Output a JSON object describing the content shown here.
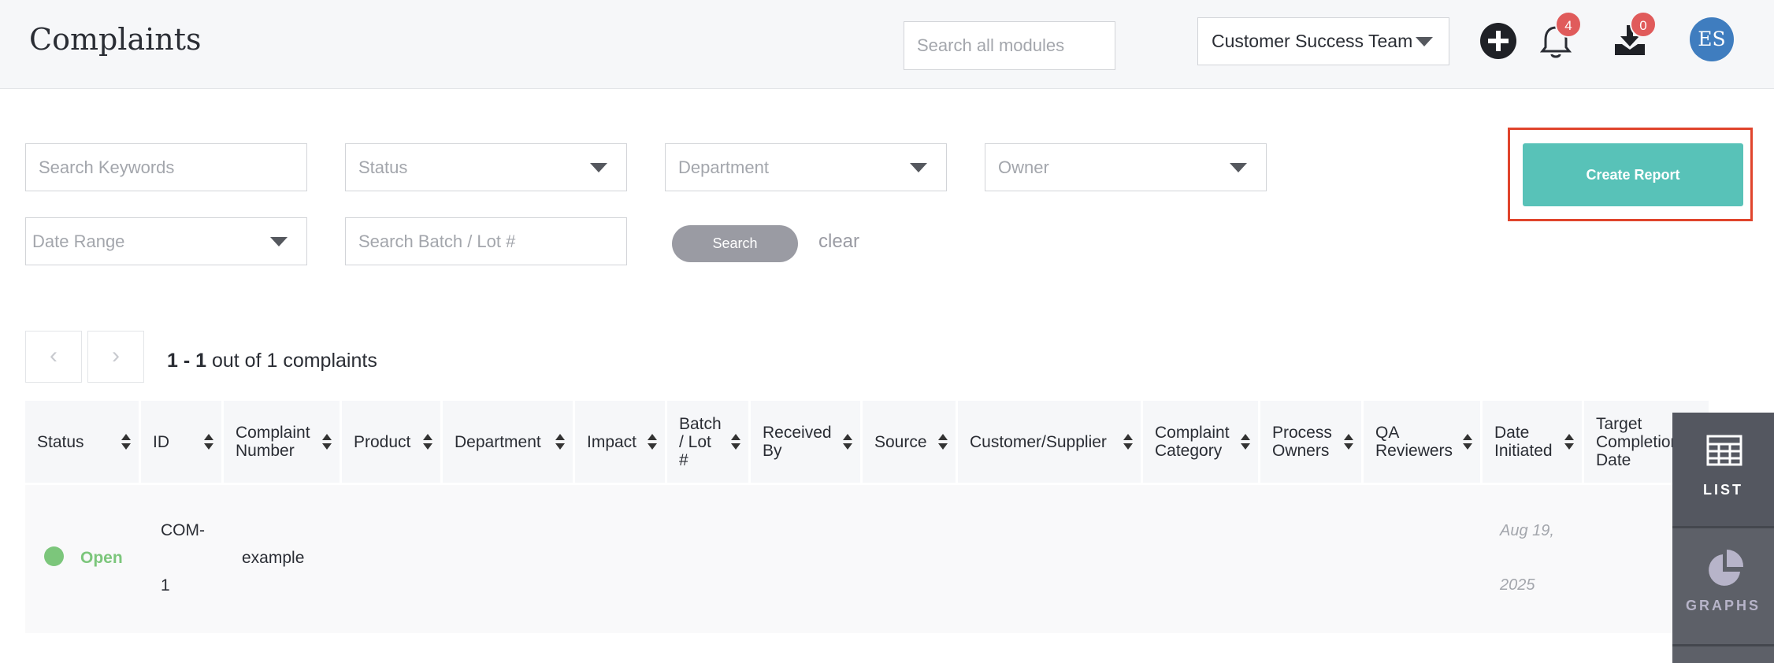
{
  "header": {
    "title": "Complaints",
    "search_placeholder": "Search all modules",
    "team_selected": "Customer Success Team",
    "notifications_count": "4",
    "downloads_count": "0",
    "avatar_initials": "ES"
  },
  "filters": {
    "keywords_placeholder": "Search Keywords",
    "status_label": "Status",
    "department_label": "Department",
    "owner_label": "Owner",
    "date_range_label": "Date Range",
    "batch_placeholder": "Search Batch / Lot #",
    "search_label": "Search",
    "clear_label": "clear",
    "create_report_label": "Create Report"
  },
  "pager": {
    "prev_symbol": "‹",
    "next_symbol": "›",
    "range": "1 - 1",
    "summary": " out of 1 complaints"
  },
  "table": {
    "columns": [
      "Status",
      "ID",
      "Complaint Number",
      "Product",
      "Department",
      "Impact",
      "Batch / Lot #",
      "Received By",
      "Source",
      "Customer/Supplier",
      "Complaint Category",
      "Process Owners",
      "QA Reviewers",
      "Date Initiated",
      "Target Completion Date"
    ],
    "rows": [
      {
        "status": "Open",
        "id_line1": "COM-",
        "id_line2": "1",
        "complaint_number": "example",
        "date_line1": "Aug 19,",
        "date_line2": "2025"
      }
    ]
  },
  "side_panel": {
    "list_label": "LIST",
    "graphs_label": "GRAPHS"
  },
  "colors": {
    "accent": "#58c2b8",
    "status_open": "#7cc67b",
    "badge": "#e05b5b",
    "avatar": "#3f7dbf",
    "highlight": "#e0442c"
  }
}
